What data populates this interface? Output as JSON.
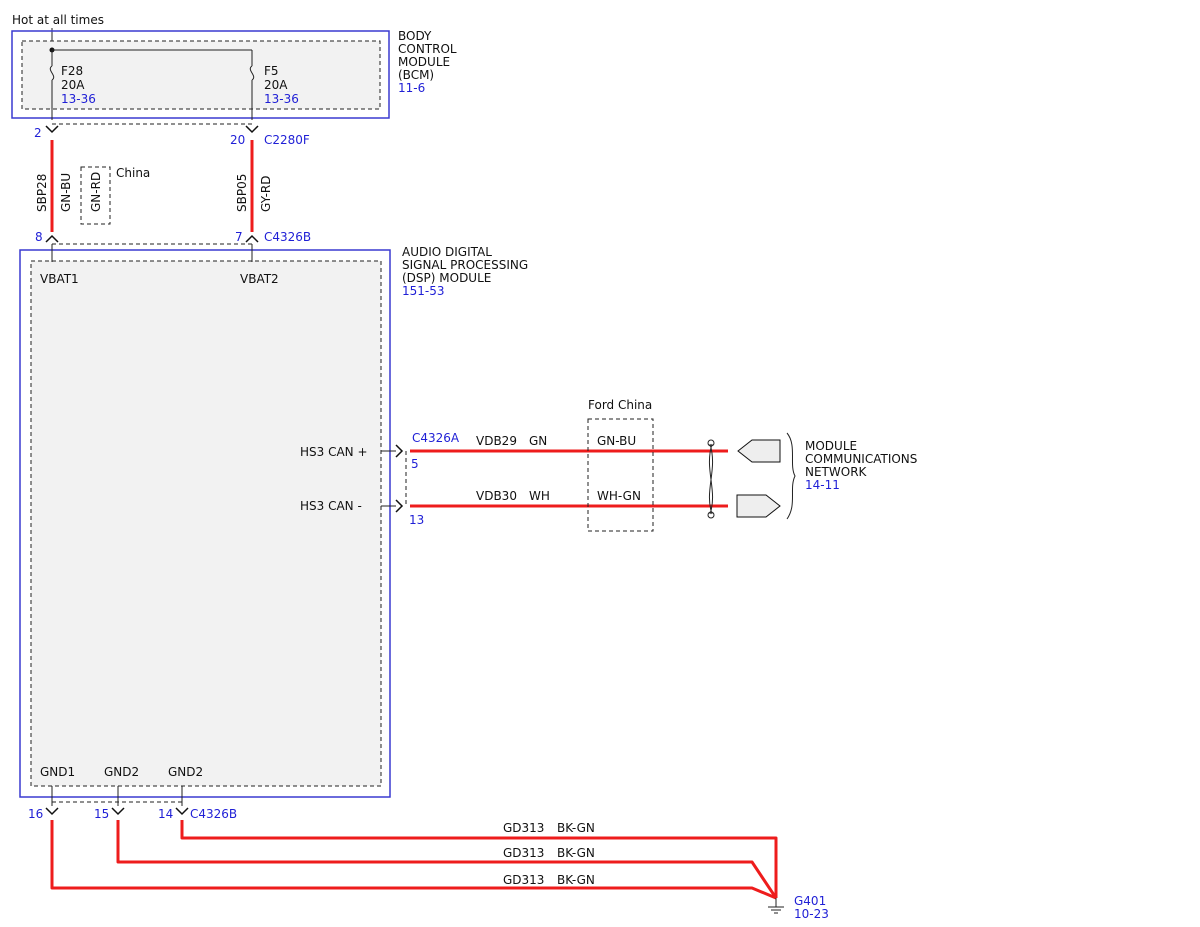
{
  "header": {
    "hot_at_all_times": "Hot at all times"
  },
  "bcm": {
    "title_lines": [
      "BODY",
      "CONTROL",
      "MODULE",
      "(BCM)"
    ],
    "ref": "11-6",
    "fuses": [
      {
        "id": "F28",
        "rating": "20A",
        "ref": "13-36"
      },
      {
        "id": "F5",
        "rating": "20A",
        "ref": "13-36"
      }
    ]
  },
  "bcm_connector": {
    "pins": [
      "2",
      "20"
    ],
    "name": "C2280F"
  },
  "supply_wires": [
    {
      "circuit": "SBP28",
      "color": "GN-BU"
    },
    {
      "circuit": "SBP05",
      "color": "GY-RD"
    }
  ],
  "china_option": {
    "color": "GN-RD",
    "label": "China"
  },
  "dsp_top_connector": {
    "pins": [
      "8",
      "7"
    ],
    "name": "C4326B"
  },
  "dsp": {
    "title_lines": [
      "AUDIO DIGITAL",
      "SIGNAL PROCESSING",
      "(DSP) MODULE"
    ],
    "ref": "151-53",
    "inputs": [
      "VBAT1",
      "VBAT2"
    ],
    "can_pins": [
      "HS3 CAN +",
      "HS3 CAN -"
    ],
    "grounds": [
      "GND1",
      "GND2",
      "GND2"
    ]
  },
  "can_connector": {
    "name": "C4326A",
    "pins": [
      "5",
      "13"
    ]
  },
  "can_wires": [
    {
      "circuit": "VDB29",
      "color": "GN",
      "china_color": "GN-BU"
    },
    {
      "circuit": "VDB30",
      "color": "WH",
      "china_color": "WH-GN"
    }
  ],
  "ford_china": {
    "label": "Ford China"
  },
  "network": {
    "lines": [
      "MODULE",
      "COMMUNICATIONS",
      "NETWORK"
    ],
    "ref": "14-11"
  },
  "ground_connector": {
    "pins": [
      "16",
      "15",
      "14"
    ],
    "name": "C4326B"
  },
  "ground_wires": [
    {
      "circuit": "GD313",
      "color": "BK-GN"
    },
    {
      "circuit": "GD313",
      "color": "BK-GN"
    },
    {
      "circuit": "GD313",
      "color": "BK-GN"
    }
  ],
  "ground_point": {
    "name": "G401",
    "ref": "10-23"
  }
}
